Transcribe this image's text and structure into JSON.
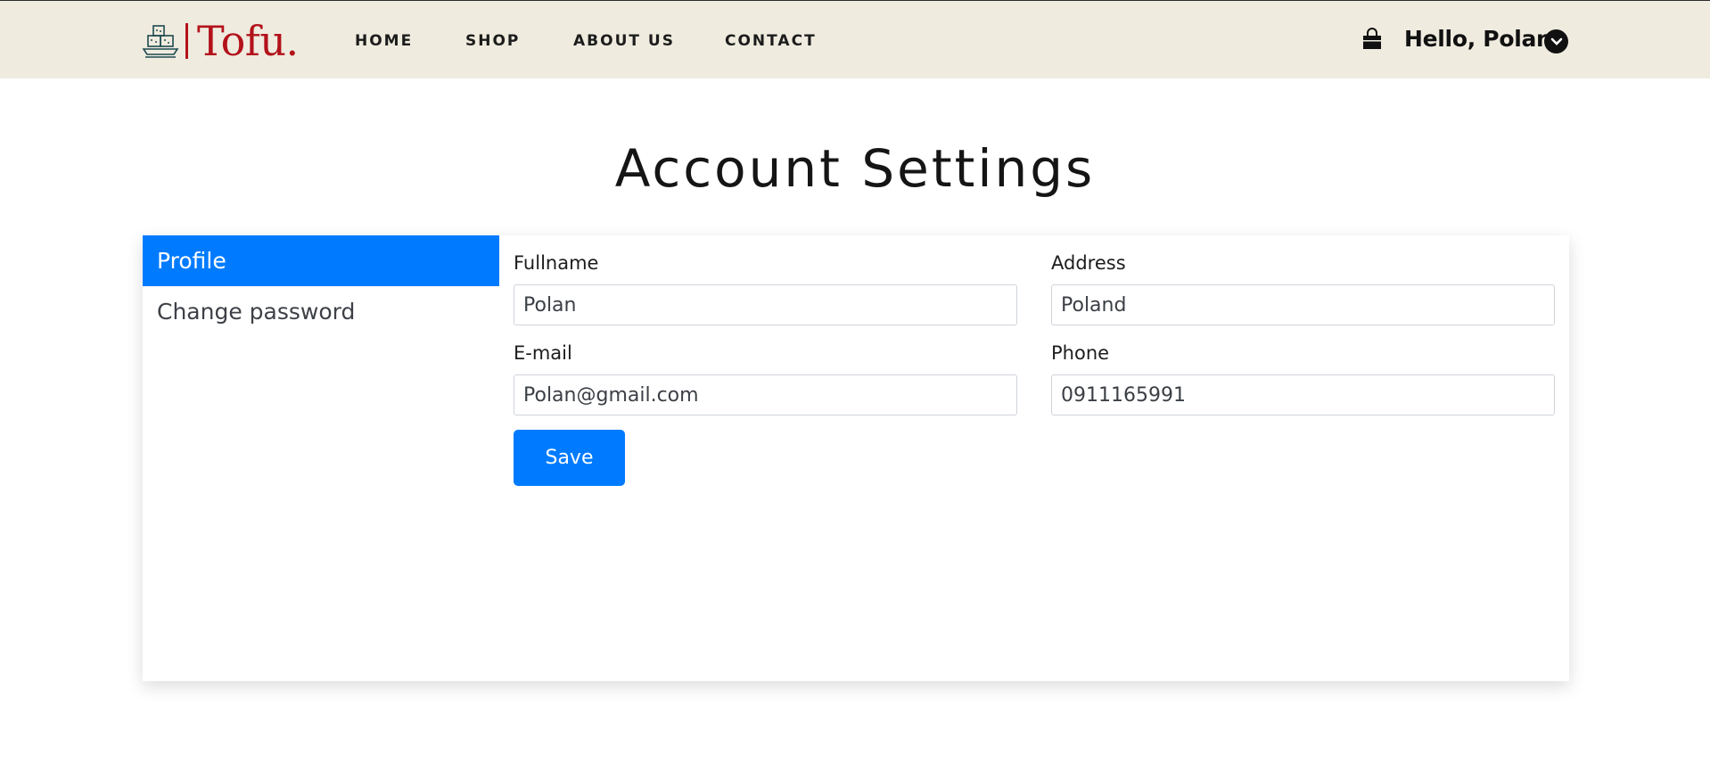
{
  "brand": {
    "name": "Tofu.",
    "color": "#b3121b",
    "icon": "tofu-logo-icon"
  },
  "nav": {
    "items": [
      {
        "label": "HOME"
      },
      {
        "label": "SHOP"
      },
      {
        "label": "ABOUT US"
      },
      {
        "label": "CONTACT"
      }
    ]
  },
  "user": {
    "greeting": "Hello, Polan",
    "cart_icon": "shopping-bag-icon",
    "menu_icon": "chevron-down-icon"
  },
  "page": {
    "title": "Account Settings"
  },
  "sidebar": {
    "items": [
      {
        "label": "Profile",
        "active": true
      },
      {
        "label": "Change password",
        "active": false
      }
    ]
  },
  "form": {
    "fullname": {
      "label": "Fullname",
      "value": "Polan"
    },
    "address": {
      "label": "Address",
      "value": "Poland"
    },
    "email": {
      "label": "E-mail",
      "value": "Polan@gmail.com"
    },
    "phone": {
      "label": "Phone",
      "value": "0911165991"
    },
    "save_label": "Save"
  },
  "colors": {
    "header_bg": "#efebdf",
    "accent": "#007bff"
  }
}
